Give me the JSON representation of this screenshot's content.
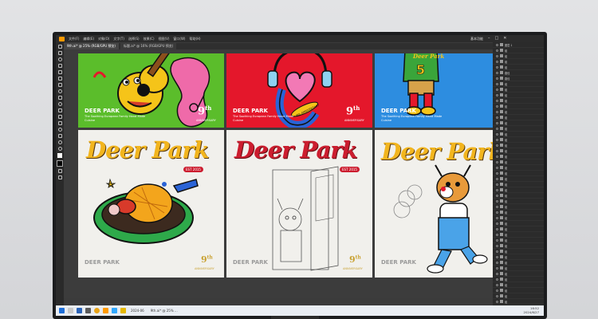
{
  "menubar": {
    "items": [
      "文件(F)",
      "编辑(E)",
      "对象(O)",
      "文字(T)",
      "选择(S)",
      "效果(C)",
      "视图(V)",
      "窗口(W)",
      "帮助(H)"
    ],
    "workspace": "基本功能"
  },
  "tabs": [
    {
      "label": "9th.ai* @ 25% (RGB/GPU 预览)",
      "active": true
    },
    {
      "label": "标题.ai* @ 16% (RGB/GPU 预览)",
      "active": false
    }
  ],
  "artboards_top": [
    {
      "brand": "DEER PARK",
      "sub": "The Soothing European Family Hand Made Cuisine",
      "nine": "9",
      "nine_sup": "th",
      "anniv": "ANNIVERSARY",
      "color": "#5bbd2b"
    },
    {
      "brand": "DEER PARK",
      "sub": "The Soothing European Family Hand Made Cuisine",
      "nine": "9",
      "nine_sup": "th",
      "anniv": "ANNIVERSARY",
      "color": "#e4172b"
    },
    {
      "brand": "DEER PARK",
      "sub": "The Soothing European Family Hand Made Cuisine",
      "color": "#2d8de0",
      "shirt_text": "Deer Park",
      "shirt_num": "5"
    }
  ],
  "artboards_bottom": [
    {
      "script": "Deer Park",
      "est": "EST 2015",
      "brand": "DEER PARK",
      "nine": "9",
      "nine_sup": "th",
      "anniv": "ANNIVERSARY"
    },
    {
      "script": "Deer Park",
      "est": "EST 2015",
      "brand": "DEER PARK",
      "nine": "9",
      "nine_sup": "th",
      "anniv": "ANNIVERSARY"
    },
    {
      "script": "Deer Park",
      "brand": "DEER PARK"
    }
  ],
  "badge_text": "9th ANNIVERSARY",
  "layers": [
    "图层 1",
    "组",
    "组",
    "组",
    "组",
    "路径",
    "路径",
    "组",
    "组",
    "组",
    "组",
    "组",
    "组",
    "组",
    "组",
    "组",
    "组",
    "组",
    "组",
    "组",
    "组",
    "组",
    "组",
    "组",
    "组",
    "组",
    "组",
    "组",
    "组",
    "组",
    "组",
    "组",
    "组",
    "组",
    "组",
    "组",
    "组",
    "组",
    "组",
    "组",
    "组",
    "组",
    "组",
    "组",
    "组",
    "组",
    "组",
    "组"
  ],
  "taskbar": {
    "items": [
      "2024-06",
      "9th.ai* @ 25% ..."
    ],
    "time": "16:52",
    "date": "2024/6/27"
  },
  "colors": {
    "green": "#5bbd2b",
    "red": "#e4172b",
    "blue": "#2d8de0",
    "gold": "#f2b51e",
    "accent_red": "#cc1d2f"
  }
}
